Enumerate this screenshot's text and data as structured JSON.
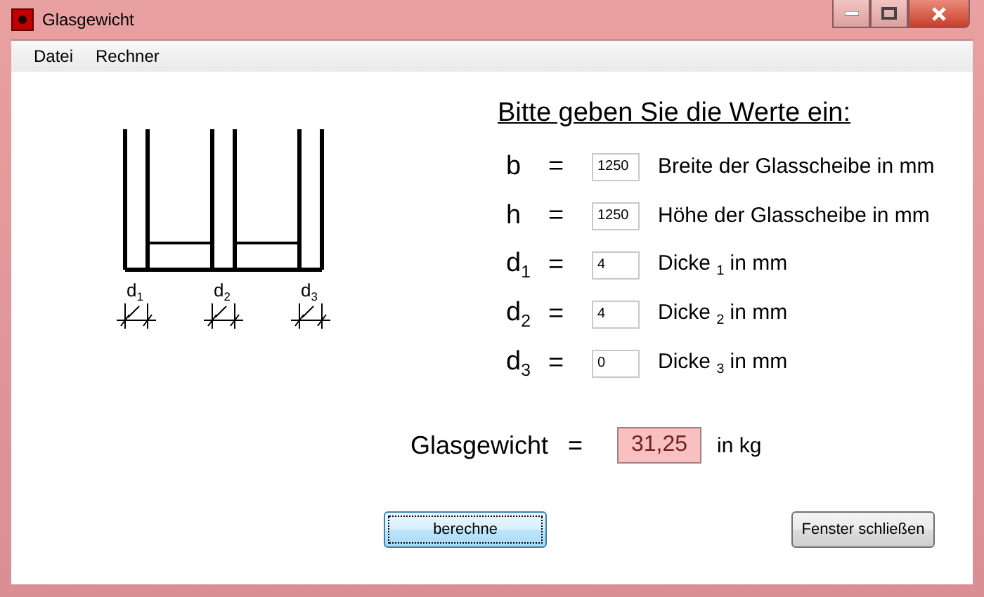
{
  "window": {
    "title": "Glasgewicht"
  },
  "menu": [
    "Datei",
    "Rechner"
  ],
  "diagram": {
    "labels": [
      "d$_{1}$",
      "d$_{2}$",
      "d$_{3}$"
    ]
  },
  "form": {
    "heading": "Bitte geben Sie die Werte ein:",
    "rows": [
      {
        "symbol": "b",
        "equals": "=",
        "value": "1250",
        "description": "Breite der Glasscheibe in mm"
      },
      {
        "symbol": "h",
        "equals": "=",
        "value": "1250",
        "description": "Höhe der Glasscheibe in mm"
      },
      {
        "symbol": "d$_{1}$",
        "equals": "=",
        "value": "4",
        "description": "Dicke $_{1}$ in mm"
      },
      {
        "symbol": "d$_{2}$",
        "equals": "=",
        "value": "4",
        "description": "Dicke $_{2}$ in mm"
      },
      {
        "symbol": "d$_{3}$",
        "equals": "=",
        "value": "0",
        "description": "Dicke $_{3}$ in mm"
      }
    ]
  },
  "result": {
    "label": "Glasgewicht",
    "equals": "=",
    "value": "31,25",
    "unit": "in kg"
  },
  "buttons": [
    {
      "label": "berechne",
      "focused": true
    },
    {
      "label": "Fenster schließen",
      "focused": false
    }
  ]
}
